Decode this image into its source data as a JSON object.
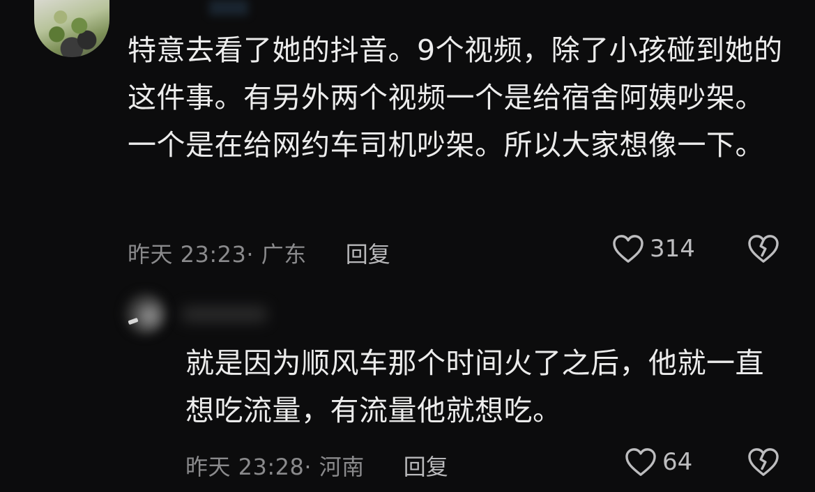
{
  "comments": [
    {
      "text": "特意去看了她的抖音。9个视频，除了小孩碰到她的这件事。有另外两个视频一个是给宿舍阿姨吵架。一个是在给网约车司机吵架。所以大家想像一下。",
      "time": "昨天 23:23· 广东",
      "reply_label": "回复",
      "likes": "314",
      "like_icon": "heart-outline-icon",
      "dislike_icon": "broken-heart-icon"
    },
    {
      "text": "就是因为顺风车那个时间火了之后，他就一直想吃流量，有流量他就想吃。",
      "time": "昨天 23:28· 河南",
      "reply_label": "回复",
      "likes": "64",
      "like_icon": "heart-outline-icon",
      "dislike_icon": "broken-heart-icon"
    }
  ],
  "colors": {
    "background": "#0c0c0d",
    "text": "#ececec",
    "meta": "#8a8a8c",
    "icon": "#bdbdbf"
  }
}
